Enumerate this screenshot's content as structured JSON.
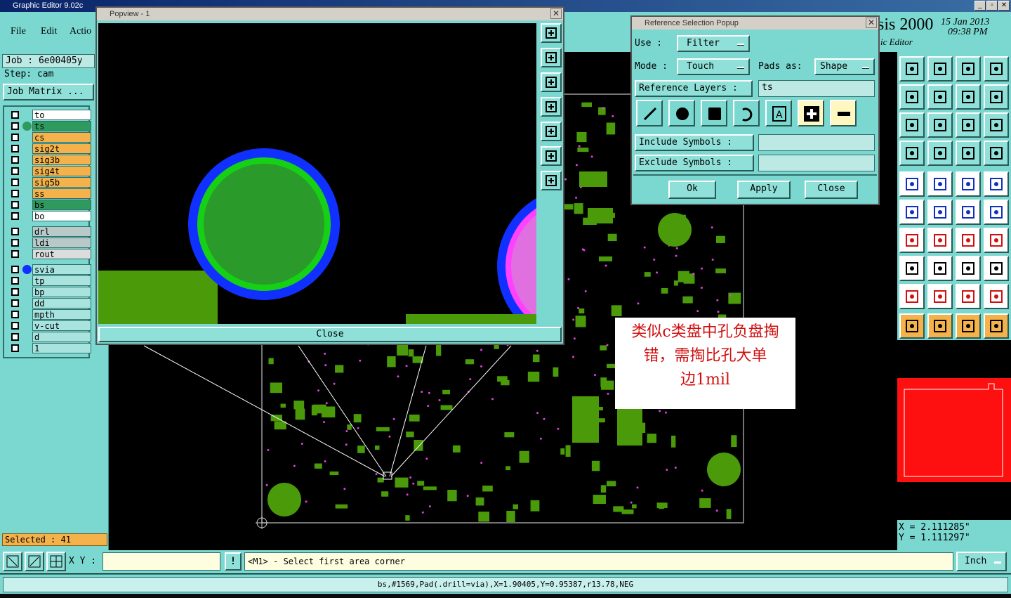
{
  "window": {
    "title": "Graphic Editor 9.02c"
  },
  "menu": {
    "file": "File",
    "edit": "Edit",
    "action": "Actio"
  },
  "job": {
    "job_label": "Job : 6e00405y",
    "step_label": "Step: cam",
    "matrix_button": "Job Matrix ..."
  },
  "layers": [
    {
      "name": "to",
      "color": "#ffffff"
    },
    {
      "name": "ts",
      "color": "#2f9a5e"
    },
    {
      "name": "cs",
      "color": "#f5b24a"
    },
    {
      "name": "sig2t",
      "color": "#f5b24a"
    },
    {
      "name": "sig3b",
      "color": "#f5b24a"
    },
    {
      "name": "sig4t",
      "color": "#f5b24a"
    },
    {
      "name": "sig5b",
      "color": "#f5b24a"
    },
    {
      "name": "ss",
      "color": "#f5b24a"
    },
    {
      "name": "bs",
      "color": "#2f9a5e"
    },
    {
      "name": "bo",
      "color": "#ffffff"
    },
    {
      "name": "drl",
      "color": "#b8c9c8"
    },
    {
      "name": "ldi",
      "color": "#b8c9c8"
    },
    {
      "name": "rout",
      "color": "#dcdcdc"
    },
    {
      "name": "svia",
      "color": "#a9e3de"
    },
    {
      "name": "tp",
      "color": "#a9e3de"
    },
    {
      "name": "bp",
      "color": "#a9e3de"
    },
    {
      "name": "dd",
      "color": "#a9e3de"
    },
    {
      "name": "mpth",
      "color": "#a9e3de"
    },
    {
      "name": "v-cut",
      "color": "#a9e3de"
    },
    {
      "name": "d",
      "color": "#a9e3de"
    },
    {
      "name": "1",
      "color": "#a9e3de"
    }
  ],
  "selected": "Selected : 41",
  "brand": {
    "title": "sis 2000",
    "subtitle": "ic Editor",
    "date": "15 Jan 2013",
    "time": "09:38 PM"
  },
  "popview": {
    "title": "Popview - 1",
    "close_label": "Close"
  },
  "refpopup": {
    "title": "Reference Selection Popup",
    "use_label": "Use  :",
    "use_value": "Filter",
    "mode_label": "Mode :",
    "mode_value": "Touch",
    "pads_label": "Pads as:",
    "pads_value": "Shape",
    "ref_layers_label": "Reference Layers :",
    "ref_layers_value": "ts",
    "include_label": "Include Symbols :",
    "include_value": "",
    "exclude_label": "Exclude Symbols :",
    "exclude_value": "",
    "ok_label": "Ok",
    "apply_label": "Apply",
    "close_label": "Close"
  },
  "note": {
    "line1": "类似c类盘中孔负盘掏",
    "line2": "错，需掏比孔大单",
    "line3": "边1mil"
  },
  "coords": {
    "x": "X = 2.111285\"",
    "y": "Y = 1.111297\""
  },
  "bottom": {
    "xy_label": "X Y :",
    "xy_value": "",
    "prompt": "<M1> - Select first area corner",
    "units": "Inch"
  },
  "status": {
    "text": "bs,#1569,Pad(.drill=via),X=1.90405,Y=0.95387,r13.78,NEG"
  },
  "colors": {
    "teal": "#7ad8d0",
    "pcb_green": "#4a9a0a",
    "via_magenta": "#e040e0",
    "highlight_red": "#ff1010",
    "pad_blue": "#1030ff"
  }
}
